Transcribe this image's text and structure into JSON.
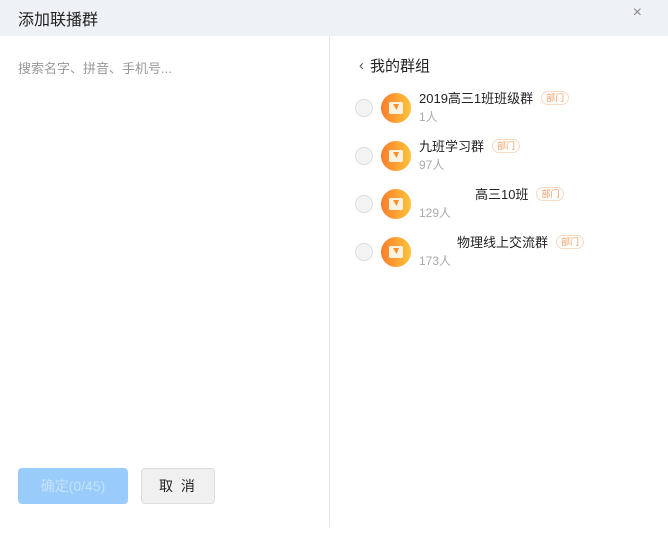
{
  "dialog": {
    "title": "添加联播群",
    "close_icon": "×"
  },
  "search": {
    "placeholder": "搜索名字、拼音、手机号..."
  },
  "buttons": {
    "confirm": "确定(0/45)",
    "cancel": "取 消"
  },
  "breadcrumb": {
    "back_icon": "‹",
    "label": "我的群组"
  },
  "groups": [
    {
      "name": "2019高三1班班级群",
      "tag": "部门",
      "count": "1人"
    },
    {
      "name": "九班学习群",
      "tag": "部门",
      "count": "97人"
    },
    {
      "name": "高三10班",
      "tag": "部门",
      "count": "129人"
    },
    {
      "name": "物理线上交流群",
      "tag": "部门",
      "count": "173人"
    }
  ]
}
